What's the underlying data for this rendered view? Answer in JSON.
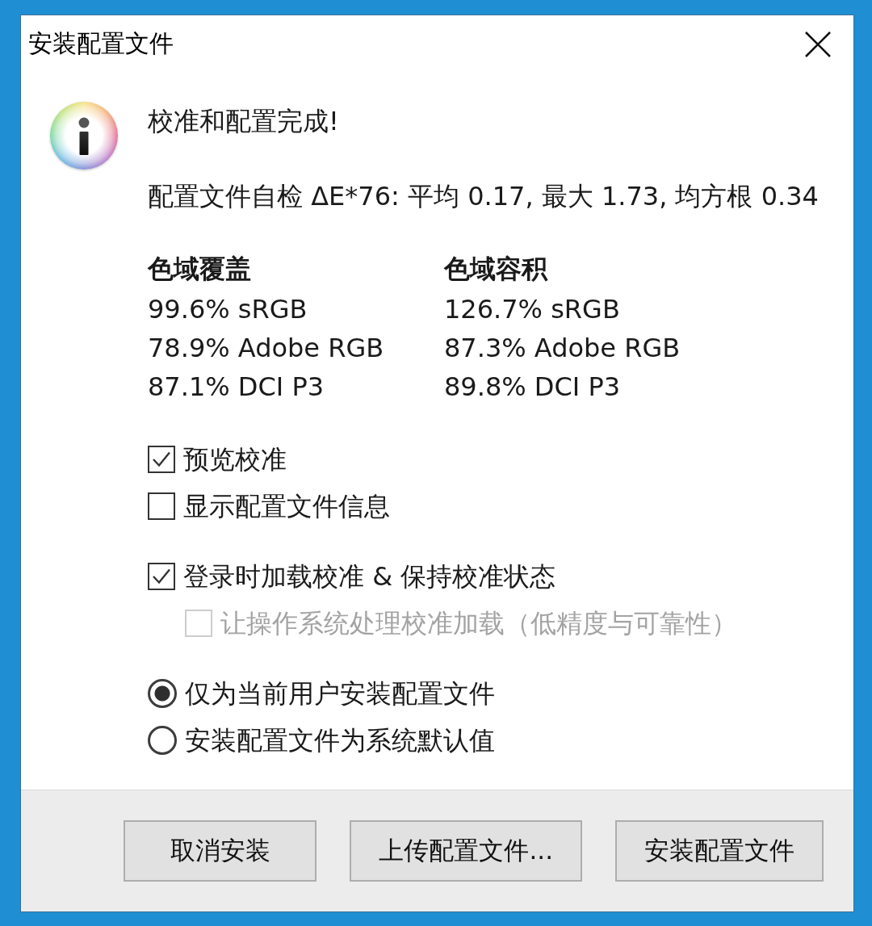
{
  "window": {
    "title": "安装配置文件"
  },
  "message": {
    "heading": "校准和配置完成!",
    "self_check": "配置文件自检 ΔE*76: 平均 0.17, 最大 1.73, 均方根 0.34"
  },
  "gamut_columns": [
    {
      "heading": "色域覆盖",
      "values": [
        "99.6% sRGB",
        "78.9% Adobe RGB",
        "87.1% DCI P3"
      ]
    },
    {
      "heading": "色域容积",
      "values": [
        "126.7% sRGB",
        "87.3% Adobe RGB",
        "89.8% DCI P3"
      ]
    }
  ],
  "option_groups": [
    {
      "items": [
        {
          "kind": "checkbox",
          "label": "预览校准",
          "checked": true,
          "disabled": false
        },
        {
          "kind": "checkbox",
          "label": "显示配置文件信息",
          "checked": false,
          "disabled": false
        }
      ]
    },
    {
      "items": [
        {
          "kind": "checkbox",
          "label": "登录时加载校准 & 保持校准状态",
          "checked": true,
          "disabled": false,
          "children": [
            {
              "kind": "checkbox",
              "label": "让操作系统处理校准加载（低精度与可靠性）",
              "checked": false,
              "disabled": true
            }
          ]
        }
      ]
    },
    {
      "items": [
        {
          "kind": "radio",
          "label": "仅为当前用户安装配置文件",
          "selected": true
        },
        {
          "kind": "radio",
          "label": "安装配置文件为系统默认值",
          "selected": false
        }
      ]
    }
  ],
  "buttons": [
    "取消安装",
    "上传配置文件...",
    "安装配置文件"
  ]
}
